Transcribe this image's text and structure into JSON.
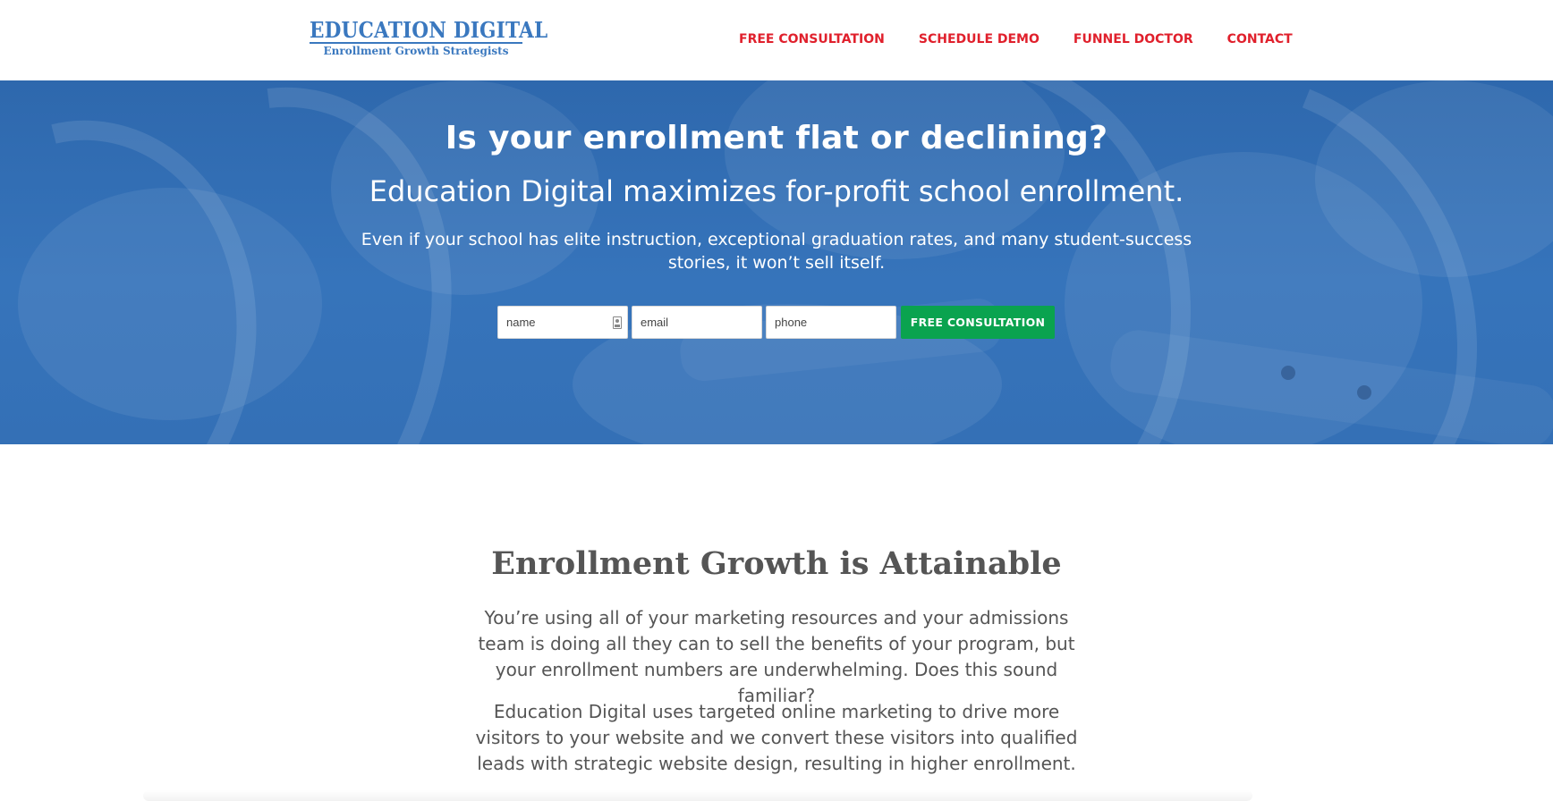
{
  "header": {
    "logo_title": "EDUCATION DIGITAL",
    "logo_subtitle": "Enrollment Growth Strategists",
    "nav": [
      {
        "label": "FREE CONSULTATION"
      },
      {
        "label": "SCHEDULE DEMO"
      },
      {
        "label": "FUNNEL DOCTOR"
      },
      {
        "label": "CONTACT"
      }
    ]
  },
  "hero": {
    "title": "Is your enrollment flat or declining?",
    "subtitle": "Education Digital maximizes for-profit school enrollment.",
    "text": "Even if your school has elite instruction, exceptional graduation rates, and many student-success stories, it won’t sell itself.",
    "form": {
      "name_placeholder": "name",
      "email_placeholder": "email",
      "phone_placeholder": "phone",
      "submit_label": "FREE CONSULTATION"
    }
  },
  "content": {
    "title": "Enrollment Growth is Attainable",
    "paragraph_1": "You’re using all of your marketing resources and your admissions team is doing all they can to sell the benefits of your program, but your enrollment numbers are underwhelming. Does this sound familiar?",
    "paragraph_2": "Education Digital uses targeted online marketing to drive more visitors to your website and we convert these visitors into qualified leads with strategic website design, resulting in higher enrollment."
  },
  "colors": {
    "brand_blue": "#3a78bf",
    "nav_red": "#e0202c",
    "hero_blue": "#3470b6",
    "cta_green": "#0aa34f",
    "body_text": "#555555"
  },
  "icons": {
    "name_field": "contact-card-icon"
  }
}
